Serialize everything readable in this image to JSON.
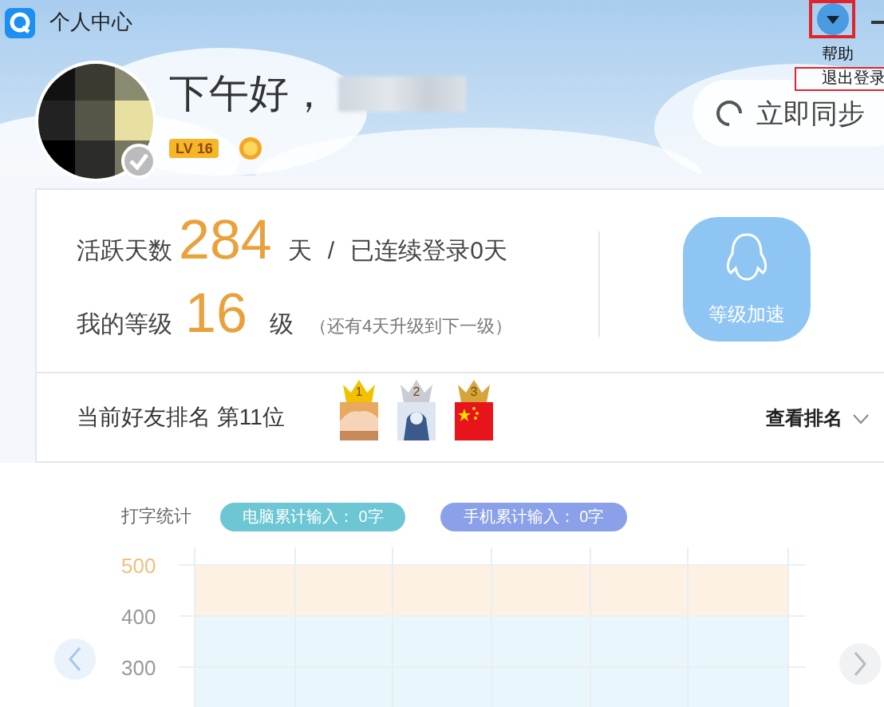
{
  "window": {
    "title": "个人中心"
  },
  "menu_button": {
    "marked": true
  },
  "menu": {
    "items": [
      {
        "label": "帮助",
        "marked": false
      },
      {
        "label": "退出登录",
        "marked": true
      }
    ]
  },
  "profile": {
    "greeting": "下午好，",
    "level_badge": "LV 16",
    "sync_button": "立即同步"
  },
  "stats": {
    "active_label": "活跃天数",
    "active_days": "284",
    "active_unit": "天",
    "separator": "/",
    "streak": "已连续登录0天",
    "grade_label": "我的等级",
    "grade": "16",
    "grade_unit": "级",
    "grade_note": "（还有4天升级到下一级）",
    "boost_button": "等级加速"
  },
  "ranking": {
    "text": "当前好友排名 第11位",
    "view_button": "查看排名",
    "friends": [
      {
        "rank": "1",
        "color": "#f2c200"
      },
      {
        "rank": "2",
        "color": "#c9ccd2"
      },
      {
        "rank": "3",
        "color": "#d6a53a"
      }
    ]
  },
  "typing": {
    "title": "打字统计",
    "pills": [
      {
        "label": "电脑累计输入： 0字",
        "color": "#6cc6d3"
      },
      {
        "label": "手机累计输入： 0字",
        "color": "#8aa0e8"
      }
    ],
    "y_ticks": [
      {
        "label": "500",
        "highlight": true
      },
      {
        "label": "400",
        "highlight": false
      },
      {
        "label": "300",
        "highlight": false
      }
    ]
  }
}
